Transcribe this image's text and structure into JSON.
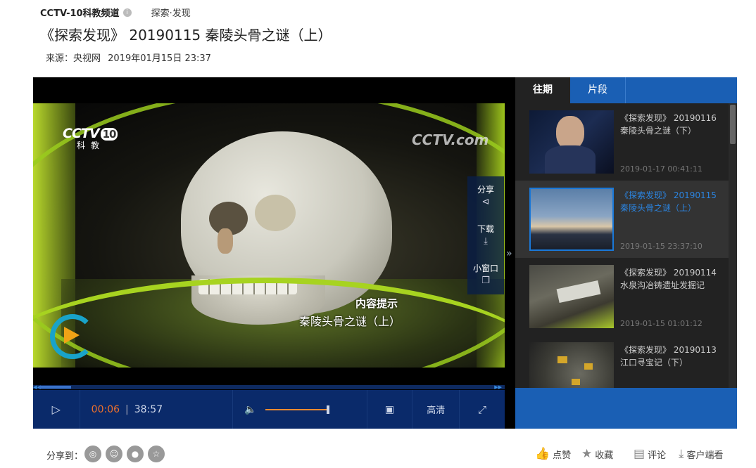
{
  "header": {
    "channel": "CCTV-10科教频道",
    "column": "探索·发现",
    "title": "《探索发现》 20190115 秦陵头骨之谜（上）",
    "source_label": "来源：央视网",
    "publish_time": "2019年01月15日 23:37"
  },
  "video": {
    "logo_main": "CCTV",
    "logo_num": "10",
    "logo_sub": "科教",
    "logo_right": "CCTV.com",
    "caption_heading": "内容提示",
    "caption_text": "秦陵头骨之谜（上）"
  },
  "sidetools": {
    "share": "分享",
    "download": "下载",
    "mini": "小窗口"
  },
  "controls": {
    "current_time": "00:06",
    "separator": "|",
    "duration": "38:57",
    "progress_fraction": 0.0026,
    "volume_fraction": 0.95,
    "quality": "高清"
  },
  "playlist": {
    "tabs": [
      {
        "label": "往期",
        "active": true
      },
      {
        "label": "片段",
        "active": false
      }
    ],
    "items": [
      {
        "title_line1": "《探索发现》 20190116",
        "title_line2": "秦陵头骨之谜（下）",
        "date": "2019-01-17 00:41:11",
        "selected": false
      },
      {
        "title_line1": "《探索发现》 20190115",
        "title_line2": "秦陵头骨之谜（上）",
        "date": "2019-01-15 23:37:10",
        "selected": true
      },
      {
        "title_line1": "《探索发现》 20190114",
        "title_line2": "水泉沟冶铸遗址发掘记",
        "date": "2019-01-15 01:01:12",
        "selected": false
      },
      {
        "title_line1": "《探索发现》 20190113",
        "title_line2": "江口寻宝记（下）",
        "date": "",
        "selected": false
      }
    ]
  },
  "footer": {
    "share_label": "分享到：",
    "like": "点赞",
    "favorite": "收藏",
    "comment": "评论",
    "client": "客户端看"
  },
  "colors": {
    "accent_blue": "#1a5fb4",
    "selected_title": "#2b84e0",
    "time_orange": "#f0702a",
    "control_bar": "#0a2a6a"
  }
}
